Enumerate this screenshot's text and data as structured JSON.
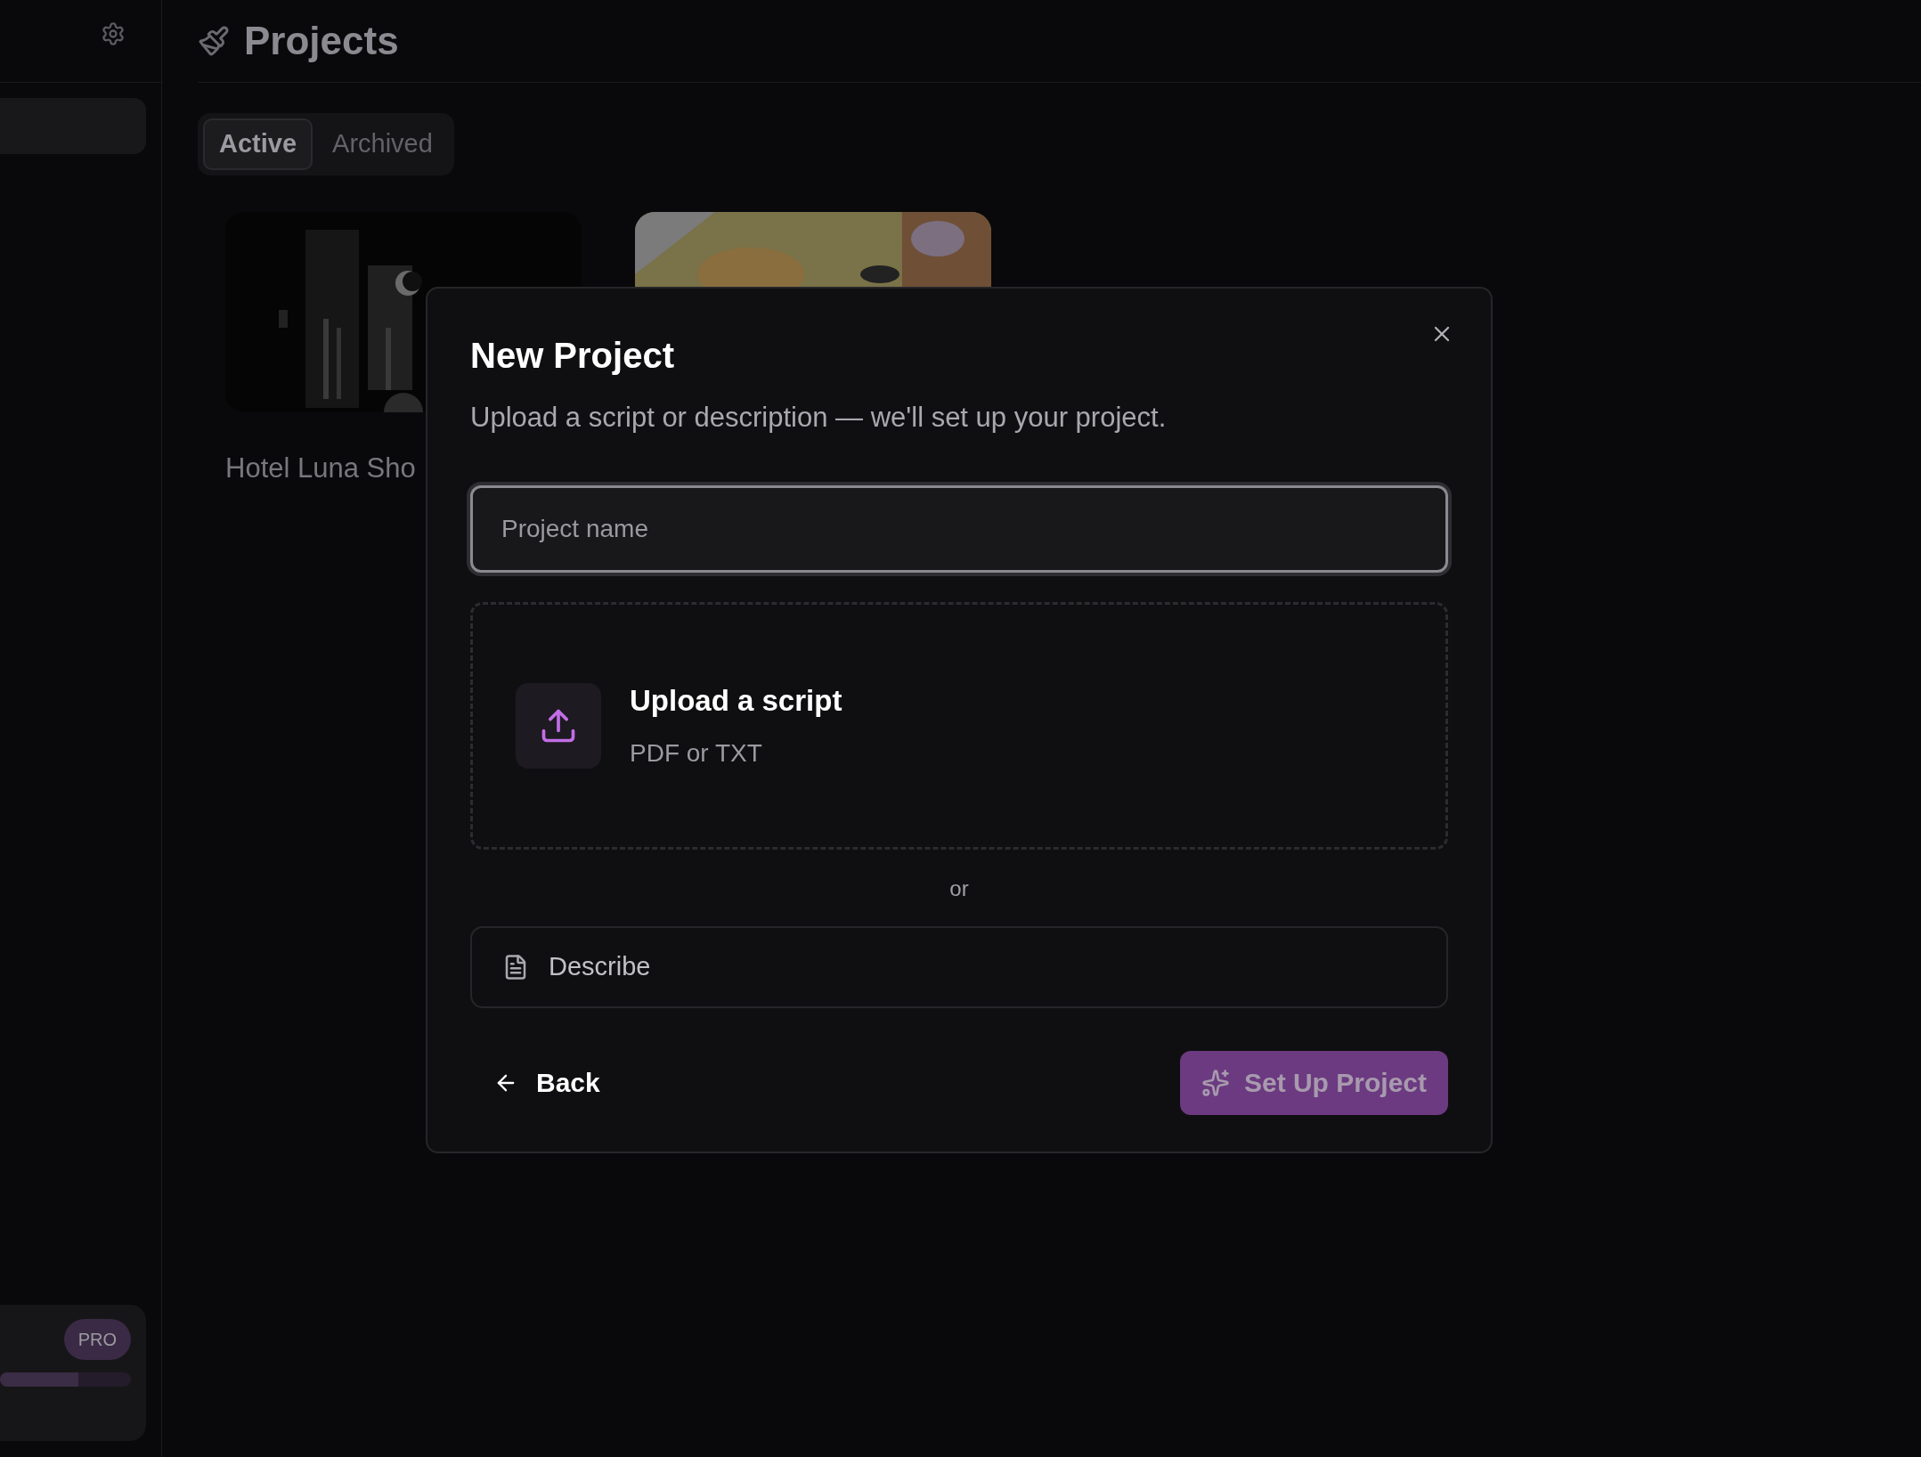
{
  "header": {
    "title": "Projects"
  },
  "tabs": [
    {
      "label": "Active",
      "selected": true
    },
    {
      "label": "Archived",
      "selected": false
    }
  ],
  "projects": [
    {
      "title": "Hotel Luna Sho",
      "kind": "picture"
    },
    {
      "kind": "picture"
    }
  ],
  "plan": {
    "badge": "PRO",
    "level": 0.6
  },
  "dialog": {
    "title": "New Project",
    "subtitle": "Upload a script or description — we'll set up your project.",
    "name_field": {
      "placeholder": "Project name"
    },
    "upload": {
      "title": "Upload a script",
      "hint": "PDF or TXT"
    },
    "separator": "or",
    "describe": "Describe",
    "back": "Back",
    "submit": {
      "label": "Set Up Project",
      "disabled": true
    }
  }
}
